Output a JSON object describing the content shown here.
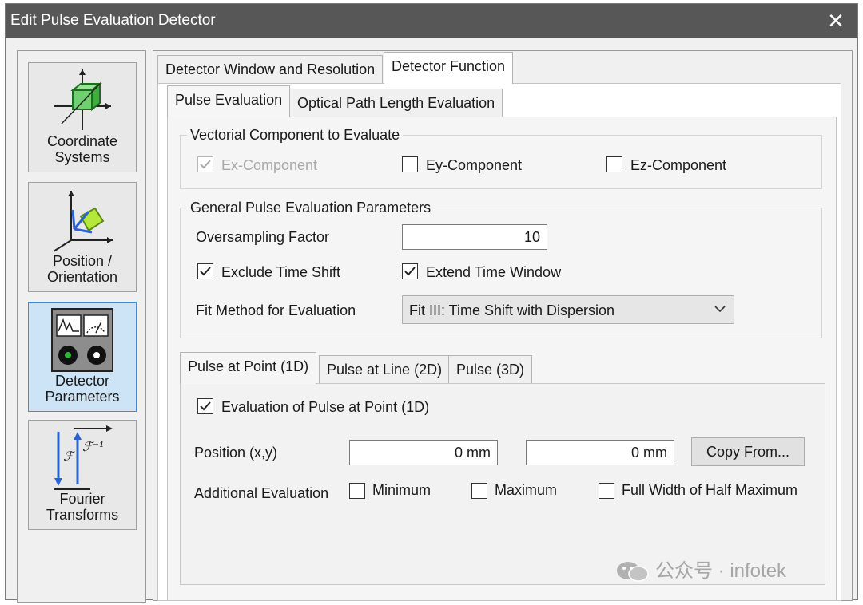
{
  "window": {
    "title": "Edit Pulse Evaluation Detector",
    "close_glyph": "✕"
  },
  "sidebar": {
    "items": [
      {
        "label": "Coordinate\nSystems",
        "icon": "coordinate-systems-icon",
        "selected": false
      },
      {
        "label": "Position /\nOrientation",
        "icon": "position-orientation-icon",
        "selected": false
      },
      {
        "label": "Detector\nParameters",
        "icon": "detector-parameters-icon",
        "selected": true
      },
      {
        "label": "Fourier\nTransforms",
        "icon": "fourier-transforms-icon",
        "selected": false
      }
    ]
  },
  "top_tabs": [
    {
      "label": "Detector Window and Resolution",
      "active": false
    },
    {
      "label": "Detector Function",
      "active": true
    }
  ],
  "sub_tabs": [
    {
      "label": "Pulse Evaluation",
      "active": true
    },
    {
      "label": "Optical Path Length Evaluation",
      "active": false
    }
  ],
  "vectorial": {
    "title": "Vectorial Component to Evaluate",
    "ex": {
      "label": "Ex-Component",
      "checked": true,
      "disabled": true
    },
    "ey": {
      "label": "Ey-Component",
      "checked": false,
      "disabled": false
    },
    "ez": {
      "label": "Ez-Component",
      "checked": false,
      "disabled": false
    }
  },
  "general": {
    "title": "General Pulse Evaluation Parameters",
    "oversampling_label": "Oversampling Factor",
    "oversampling_value": "10",
    "exclude_time_shift": {
      "label": "Exclude Time Shift",
      "checked": true
    },
    "extend_time_window": {
      "label": "Extend Time Window",
      "checked": true
    },
    "fit_method_label": "Fit Method for Evaluation",
    "fit_method_value": "Fit III: Time Shift with Dispersion"
  },
  "pulse_tabs": [
    {
      "label": "Pulse at Point (1D)",
      "active": true
    },
    {
      "label": "Pulse at Line (2D)",
      "active": false
    },
    {
      "label": "Pulse (3D)",
      "active": false
    }
  ],
  "point": {
    "evaluation": {
      "label": "Evaluation of Pulse at Point (1D)",
      "checked": true
    },
    "position_label": "Position (x,y)",
    "position_x": "0 mm",
    "position_y": "0 mm",
    "copy_button": "Copy From...",
    "additional_label": "Additional Evaluation",
    "minimum": {
      "label": "Minimum",
      "checked": false
    },
    "maximum": {
      "label": "Maximum",
      "checked": false
    },
    "fwhm": {
      "label": "Full Width of Half Maximum",
      "checked": false
    }
  },
  "watermark": {
    "text": "公众号 · infotek"
  },
  "colors": {
    "titlebar": "#575757",
    "selection": "#cde4f7",
    "selection_border": "#3c8fd8"
  }
}
